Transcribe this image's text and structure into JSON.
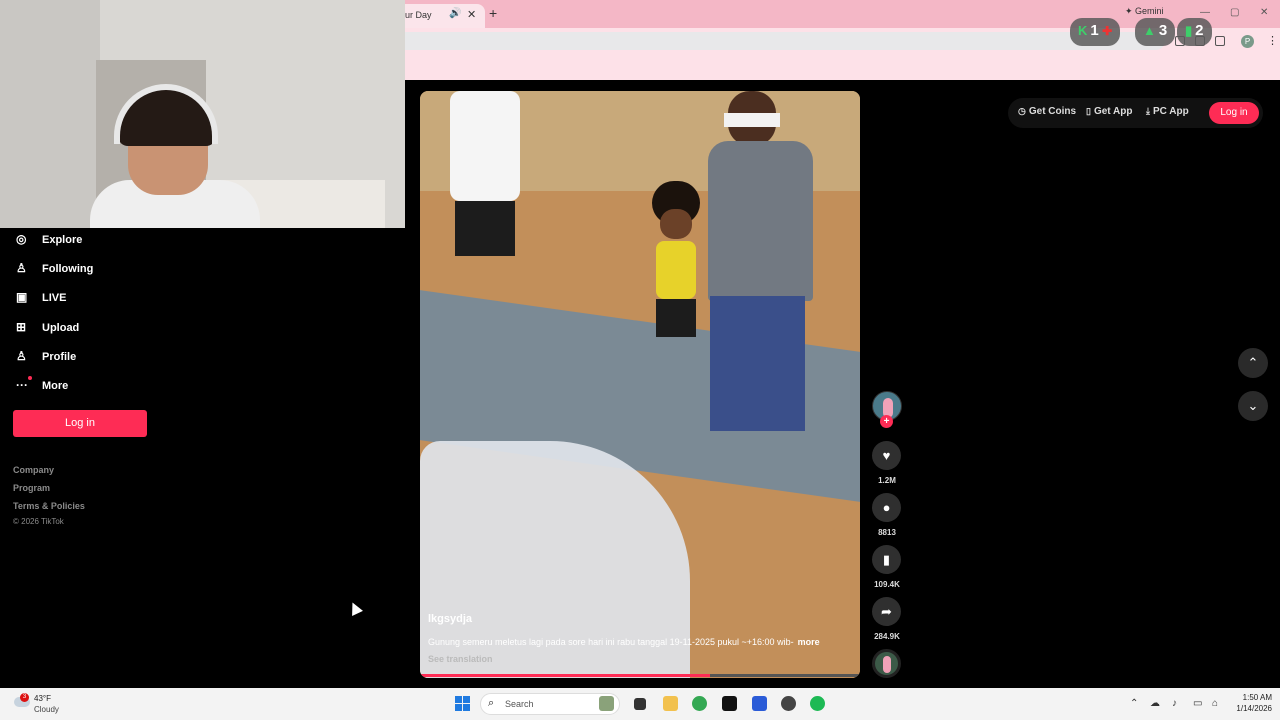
{
  "browser": {
    "tab_title": "ur Day",
    "tab_audio_icon": "speaker-icon",
    "tab_close": "✕",
    "new_tab": "+",
    "gemini_label": "Gemini",
    "profile_initial": "P"
  },
  "overlay": {
    "badges": [
      {
        "icon": "k-icon",
        "value": "1"
      },
      {
        "icon": "tree-icon",
        "value": "3"
      },
      {
        "icon": "bars-icon",
        "value": "2"
      }
    ]
  },
  "sidebar": {
    "items": [
      {
        "icon": "compass-icon",
        "label": "Explore"
      },
      {
        "icon": "following-icon",
        "label": "Following"
      },
      {
        "icon": "live-icon",
        "label": "LIVE"
      },
      {
        "icon": "upload-icon",
        "label": "Upload"
      },
      {
        "icon": "profile-icon",
        "label": "Profile"
      },
      {
        "icon": "more-icon",
        "label": "More"
      }
    ],
    "login_label": "Log in",
    "footer_links": [
      "Company",
      "Program",
      "Terms & Policies"
    ],
    "copyright": "© 2026 TikTok"
  },
  "video": {
    "username": "lkgsydja",
    "caption": "Gunung semeru meletus lagi pada sore hari ini rabu tanggal 19-11-2025 pukul ~+16:00 wib-",
    "more_label": "more",
    "see_translation": "See translation",
    "progress": 0.66
  },
  "actions": {
    "follow_plus": "+",
    "likes": "1.2M",
    "comments": "8813",
    "saves": "109.4K",
    "shares": "284.9K"
  },
  "top_actions": {
    "get_coins": "Get Coins",
    "get_app": "Get App",
    "pc_app": "PC App",
    "login": "Log in"
  },
  "taskbar": {
    "weather_temp": "43°F",
    "weather_cond": "Cloudy",
    "weather_badge": "3",
    "search_placeholder": "Search",
    "time": "1:50 AM",
    "date": "1/14/2026"
  },
  "colors": {
    "accent": "#fe2c55",
    "chrome_tab_bar": "#f4b7c6",
    "chrome_toolbar": "#fde1e8"
  }
}
